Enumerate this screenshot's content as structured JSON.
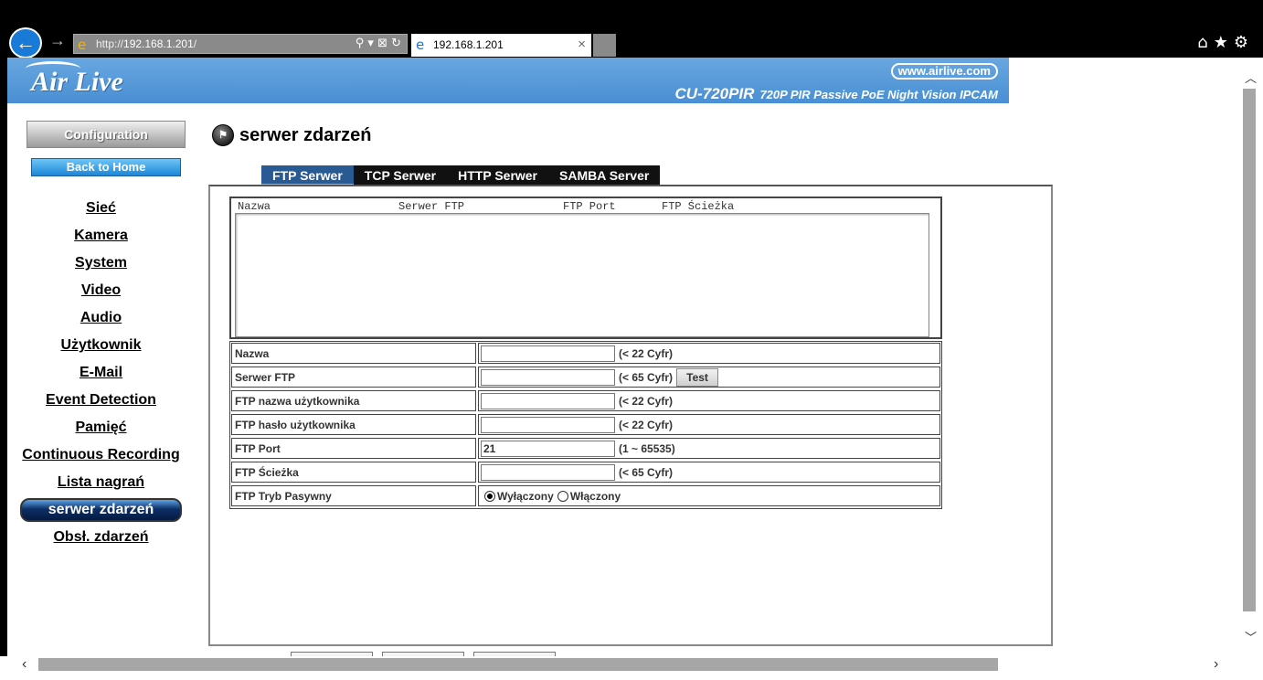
{
  "browser": {
    "url_prefix": "http://",
    "url_host": "192.168.1.201",
    "url_suffix": "/",
    "tab_title": "192.168.1.201",
    "tab_close": "×",
    "address_tools": "⚲ ▾ ⊠ ↻",
    "toolbar_icons": "⌂★⚙",
    "back_glyph": "←",
    "forward_glyph": "→",
    "ie_glyph": "e"
  },
  "banner": {
    "logo": "Air Live",
    "site_url": "www.airlive.com",
    "model": "CU-720PIR",
    "model_desc": "720P PIR Passive PoE Night Vision IPCAM",
    "color": "#4a8fd4"
  },
  "sidebar": {
    "config_label": "Configuration",
    "back_home_label": "Back to Home",
    "items": [
      {
        "label": "Sieć"
      },
      {
        "label": "Kamera"
      },
      {
        "label": "System"
      },
      {
        "label": "Video"
      },
      {
        "label": "Audio"
      },
      {
        "label": "Użytkownik"
      },
      {
        "label": "E-Mail"
      },
      {
        "label": "Event Detection"
      },
      {
        "label": "Pamięć"
      },
      {
        "label": "Continuous Recording"
      },
      {
        "label": "Lista nagrań"
      },
      {
        "label": "serwer zdarzeń",
        "active": true
      },
      {
        "label": "Obsł. zdarzeń"
      }
    ]
  },
  "page": {
    "title": "serwer zdarzeń",
    "tabs": [
      {
        "label": "FTP Serwer",
        "active": true
      },
      {
        "label": "TCP Serwer"
      },
      {
        "label": "HTTP Serwer"
      },
      {
        "label": "SAMBA Server"
      }
    ],
    "list_columns": [
      "Nazwa",
      "Serwer FTP",
      "FTP Port",
      "FTP Ścieżka"
    ],
    "form": {
      "name_label": "Nazwa",
      "name_value": "",
      "name_hint": "(< 22 Cyfr)",
      "server_label": "Serwer FTP",
      "server_value": "",
      "server_hint": "(< 65 Cyfr)",
      "test_label": "Test",
      "user_label": "FTP nazwa użytkownika",
      "user_value": "",
      "user_hint": "(< 22 Cyfr)",
      "pass_label": "FTP hasło użytkownika",
      "pass_value": "",
      "pass_hint": "(< 22 Cyfr)",
      "port_label": "FTP Port",
      "port_value": "21",
      "port_hint": "(1 ~ 65535)",
      "path_label": "FTP Ścieżka",
      "path_value": "",
      "path_hint": "(< 65 Cyfr)",
      "passive_label": "FTP Tryb Pasywny",
      "passive_off": "Wyłączony",
      "passive_on": "Włączony",
      "passive_selected": "Wyłączony"
    }
  },
  "colors": {
    "active_tab": "#2a5a94",
    "tab_bg": "#111111",
    "back_home": "#1b87d8"
  }
}
